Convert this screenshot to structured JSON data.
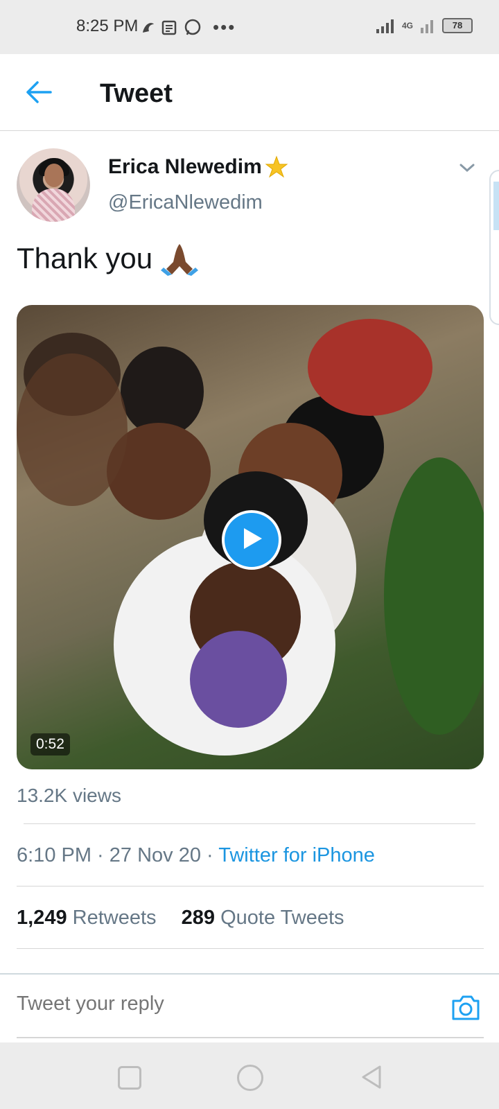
{
  "status_bar": {
    "time": "8:25 PM",
    "network": "4G",
    "battery": "78"
  },
  "header": {
    "title": "Tweet"
  },
  "tweet": {
    "author_name": "Erica Nlewedim",
    "author_handle": "@EricaNlewedim",
    "text": "Thank you",
    "video_duration": "0:52",
    "views": "13.2K views",
    "time": "6:10 PM",
    "date": "27 Nov 20",
    "source": "Twitter for iPhone",
    "retweets_count": "1,249",
    "retweets_label": "Retweets",
    "quotes_count": "289",
    "quotes_label": "Quote Tweets"
  },
  "reply": {
    "placeholder": "Tweet your reply"
  },
  "colors": {
    "accent": "#1da1f2",
    "link": "#1b95e0",
    "secondary_text": "#657786"
  },
  "icons": [
    "back-arrow-icon",
    "chevron-down-icon",
    "verified-star-icon",
    "praying-hands-icon",
    "play-icon",
    "camera-icon",
    "nav-recents-icon",
    "nav-home-icon",
    "nav-back-icon"
  ]
}
